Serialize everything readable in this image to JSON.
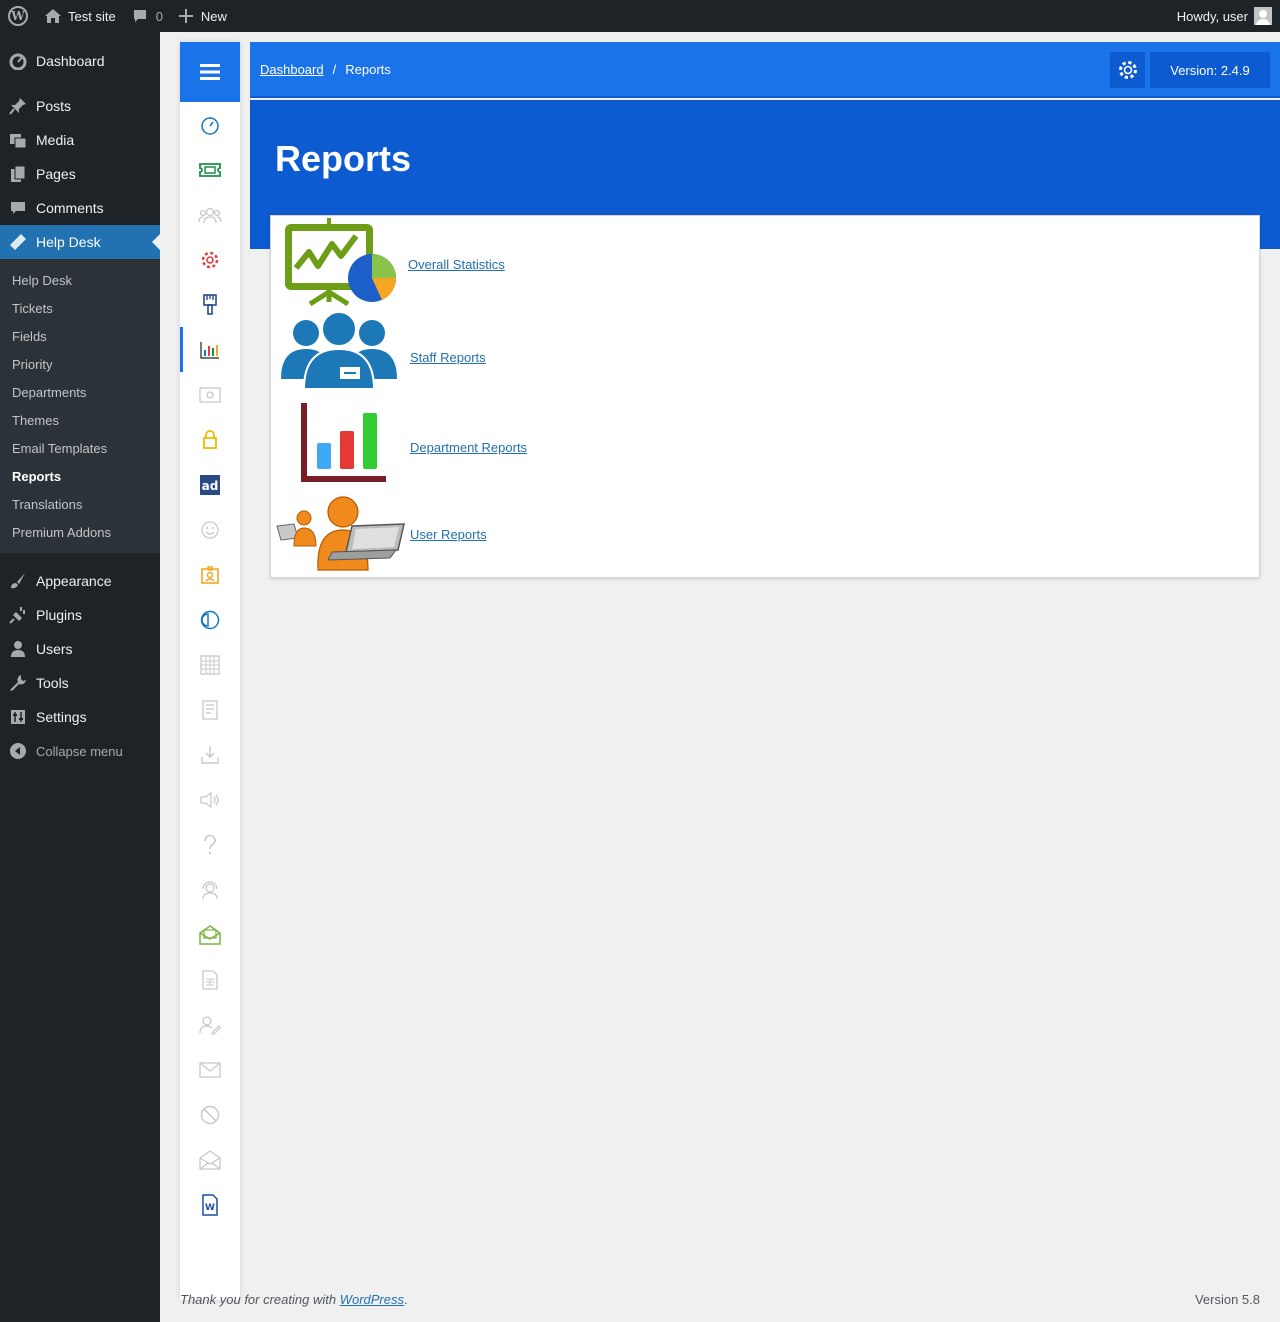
{
  "admin_bar": {
    "site_name": "Test site",
    "comments_count": "0",
    "new_label": "New",
    "greeting": "Howdy, user"
  },
  "wp_menu": {
    "items_top": [
      {
        "label": "Dashboard",
        "icon": "dashboard-icon"
      },
      {
        "label": "Posts",
        "icon": "pin-icon"
      },
      {
        "label": "Media",
        "icon": "media-icon"
      },
      {
        "label": "Pages",
        "icon": "pages-icon"
      },
      {
        "label": "Comments",
        "icon": "comment-icon"
      },
      {
        "label": "Help Desk",
        "icon": "ticket-icon"
      }
    ],
    "submenu": [
      "Help Desk",
      "Tickets",
      "Fields",
      "Priority",
      "Departments",
      "Themes",
      "Email Templates",
      "Reports",
      "Translations",
      "Premium Addons"
    ],
    "items_bottom": [
      {
        "label": "Appearance",
        "icon": "brush-icon"
      },
      {
        "label": "Plugins",
        "icon": "plugin-icon"
      },
      {
        "label": "Users",
        "icon": "user-icon"
      },
      {
        "label": "Tools",
        "icon": "wrench-icon"
      },
      {
        "label": "Settings",
        "icon": "settings-icon"
      }
    ],
    "collapse_label": "Collapse menu"
  },
  "rail_icons": [
    "dashboard-gauge-icon",
    "ticket-icon",
    "users-group-icon",
    "gear-icon",
    "paint-brush-icon",
    "bar-chart-icon",
    "email-icon",
    "lock-icon",
    "ad-icon",
    "smile-icon",
    "badge-icon",
    "half-circle-icon",
    "calculator-icon",
    "book-icon",
    "download-icon",
    "megaphone-icon",
    "question-icon",
    "support-agent-icon",
    "mail-open-icon",
    "document-icon",
    "user-edit-icon",
    "envelope-icon",
    "ban-icon",
    "envelope-open-icon",
    "word-doc-icon"
  ],
  "header": {
    "breadcrumb_home": "Dashboard",
    "breadcrumb_sep": "/",
    "breadcrumb_current": "Reports",
    "version": "Version: 2.4.9"
  },
  "page_title": "Reports",
  "reports": [
    {
      "label": " Overall Statistics",
      "icon": "presentation-chart-icon"
    },
    {
      "label": " Staff Reports",
      "icon": "staff-group-icon"
    },
    {
      "label": " Department Reports",
      "icon": "department-bar-chart-icon"
    },
    {
      "label": " User Reports",
      "icon": "user-laptop-icon"
    }
  ],
  "footer": {
    "thanks_prefix": "Thank you for creating with ",
    "thanks_link": "WordPress",
    "thanks_suffix": ".",
    "version": "Version 5.8"
  },
  "colors": {
    "accent": "#1a73e8",
    "accent_dark": "#0d5bd0",
    "wp_sidebar": "#1d2327",
    "wp_current": "#2271b1"
  }
}
